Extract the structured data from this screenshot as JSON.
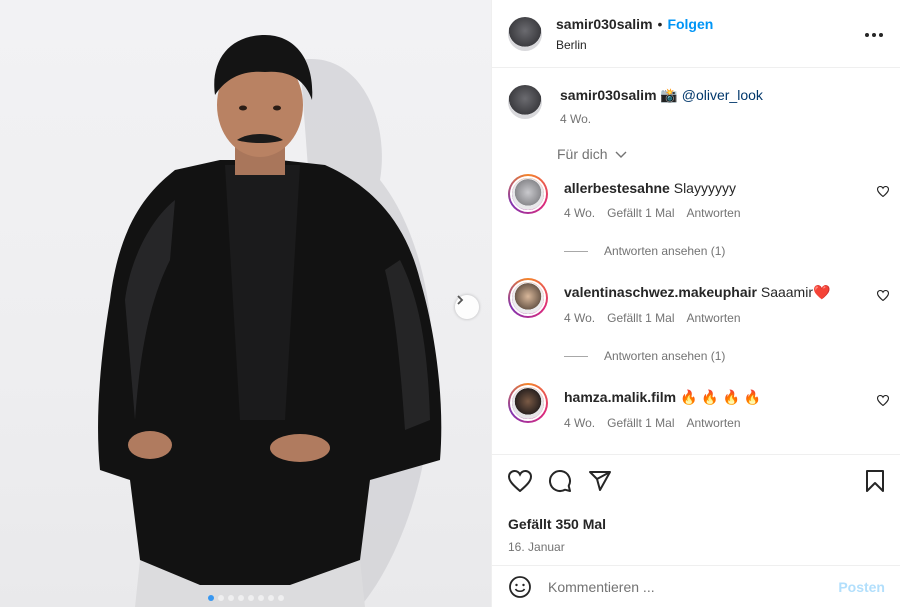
{
  "header": {
    "username": "samir030salim",
    "separator": "•",
    "follow_label": "Folgen",
    "location": "Berlin",
    "more_icon": "more-horizontal-icon"
  },
  "caption": {
    "username": "samir030salim",
    "emoji": "📸",
    "mention": "@oliver_look",
    "time": "4 Wo."
  },
  "see_translation": "Für dich",
  "comments": [
    {
      "username": "allerbestesahne",
      "text": "Slayyyyyy",
      "time": "4 Wo.",
      "likes": "Gefällt 1 Mal",
      "reply": "Antworten",
      "view_replies": "Antworten ansehen (1)"
    },
    {
      "username": "valentinaschwez.makeuphair",
      "text": "Saaamir❤️",
      "time": "4 Wo.",
      "likes": "Gefällt 1 Mal",
      "reply": "Antworten",
      "view_replies": "Antworten ansehen (1)"
    },
    {
      "username": "hamza.malik.film",
      "text": "🔥 🔥 🔥 🔥",
      "time": "4 Wo.",
      "likes": "Gefällt 1 Mal",
      "reply": "Antworten"
    }
  ],
  "actions": {
    "likes_count": "Gefällt 350 Mal",
    "date": "16. Januar"
  },
  "add_comment": {
    "placeholder": "Kommentieren ...",
    "post_label": "Posten"
  },
  "carousel": {
    "total": 8,
    "active": 1
  },
  "colors": {
    "link": "#0095f6",
    "text": "#262626",
    "muted": "#737373",
    "post_disabled": "#b2dffc"
  }
}
